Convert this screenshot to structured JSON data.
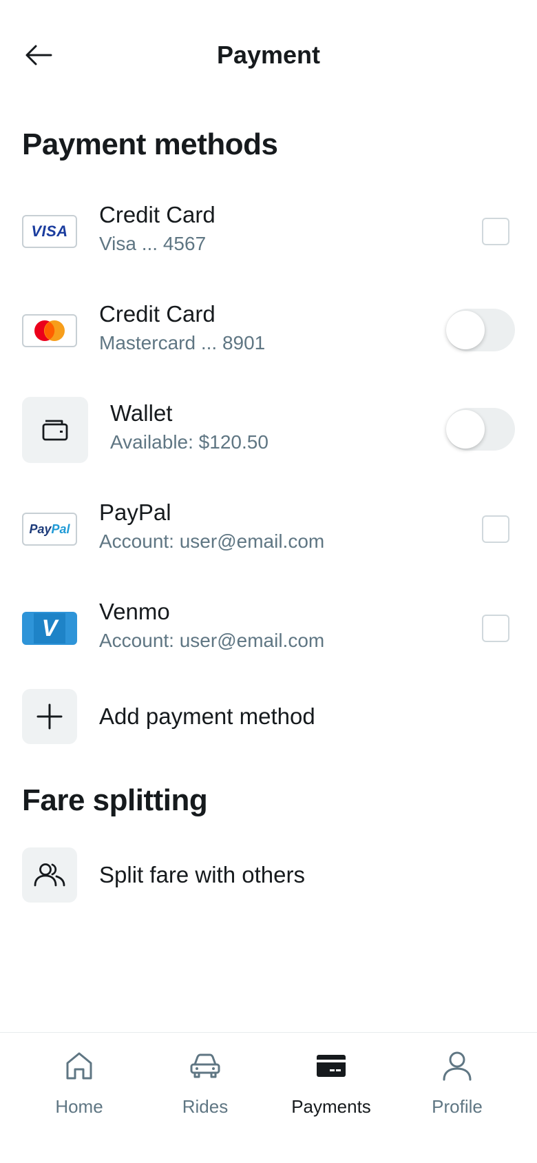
{
  "header": {
    "title": "Payment",
    "back_icon": "arrow-left-icon"
  },
  "payment_methods": {
    "section_title": "Payment methods",
    "items": [
      {
        "title": "Credit Card",
        "subtitle": "Visa ... 4567",
        "logo_text": "VISA",
        "control": "checkbox",
        "checked": false
      },
      {
        "title": "Credit Card",
        "subtitle": "Mastercard ... 8901",
        "logo": "mastercard-logo",
        "control": "toggle",
        "on": false
      },
      {
        "title": "Wallet",
        "subtitle": "Available: $120.50",
        "icon": "wallet-icon",
        "control": "toggle",
        "on": false
      },
      {
        "title": "PayPal",
        "subtitle": "Account: user@email.com",
        "logo_text_1": "Pay",
        "logo_text_2": "Pal",
        "control": "checkbox",
        "checked": false
      },
      {
        "title": "Venmo",
        "subtitle": "Account: user@email.com",
        "logo_text": "V",
        "control": "checkbox",
        "checked": false
      }
    ],
    "add_label": "Add payment method",
    "add_icon": "plus-icon"
  },
  "fare_splitting": {
    "section_title": "Fare splitting",
    "split_label": "Split fare with others",
    "split_icon": "users-icon"
  },
  "bottom_nav": {
    "items": [
      {
        "label": "Home",
        "icon": "home-icon",
        "active": false
      },
      {
        "label": "Rides",
        "icon": "car-icon",
        "active": false
      },
      {
        "label": "Payments",
        "icon": "credit-card-icon",
        "active": true
      },
      {
        "label": "Profile",
        "icon": "user-icon",
        "active": false
      }
    ]
  },
  "colors": {
    "text_primary": "#161a1d",
    "text_secondary": "#5f7683",
    "tile_background": "#eff2f3",
    "visa_blue": "#1a3c9e",
    "mastercard_red": "#eb001b",
    "mastercard_orange": "#f79e1b",
    "venmo_blue": "#2e94d8"
  }
}
